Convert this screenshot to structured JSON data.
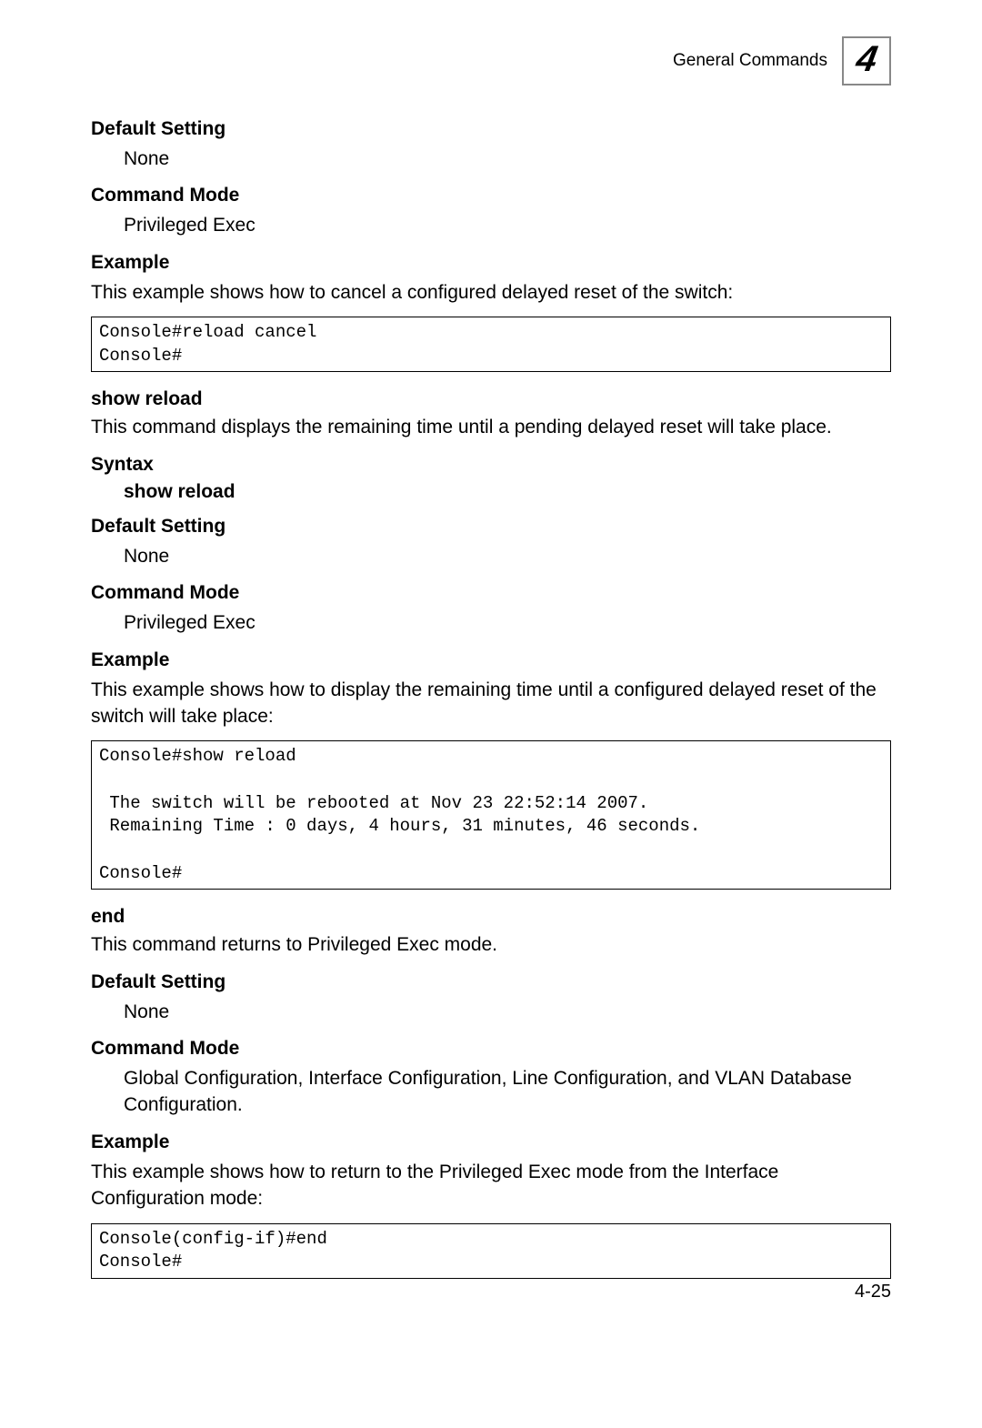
{
  "header": {
    "section_title": "General Commands",
    "chapter": "4"
  },
  "sections": {
    "reload_cancel": {
      "default_setting_h": "Default Setting",
      "default_setting_v": "None",
      "command_mode_h": "Command Mode",
      "command_mode_v": "Privileged Exec",
      "example_h": "Example",
      "example_intro": "This example shows how to cancel a configured delayed reset of the switch:",
      "example_code": "Console#reload cancel\nConsole#"
    },
    "show_reload": {
      "cmd_h": "show reload",
      "cmd_desc": "This command displays the remaining time until a pending delayed reset will take place.",
      "syntax_h": "Syntax",
      "syntax_v": "show reload",
      "default_setting_h": "Default Setting",
      "default_setting_v": "None",
      "command_mode_h": "Command Mode",
      "command_mode_v": "Privileged Exec",
      "example_h": "Example",
      "example_intro": "This example shows how to display the remaining time until a configured delayed reset of the switch will take place:",
      "example_code": "Console#show reload\n\n The switch will be rebooted at Nov 23 22:52:14 2007.\n Remaining Time : 0 days, 4 hours, 31 minutes, 46 seconds.\n\nConsole#"
    },
    "end": {
      "cmd_h": "end",
      "cmd_desc": "This command returns to Privileged Exec mode.",
      "default_setting_h": "Default Setting",
      "default_setting_v": "None",
      "command_mode_h": "Command Mode",
      "command_mode_v": "Global Configuration, Interface Configuration, Line Configuration, and VLAN Database Configuration.",
      "example_h": "Example",
      "example_intro": "This example shows how to return to the Privileged Exec mode from the Interface Configuration mode:",
      "example_code": "Console(config-if)#end\nConsole#"
    }
  },
  "page_number": "4-25"
}
